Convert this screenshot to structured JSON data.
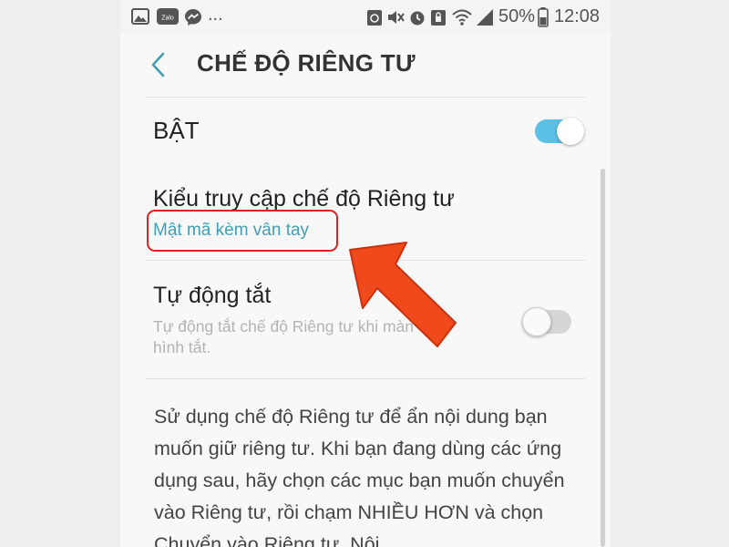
{
  "status_bar": {
    "app_icons": [
      "gallery-icon",
      "zalo-icon",
      "messenger-icon"
    ],
    "zalo_label": "Zalo",
    "more": "...",
    "battery": "50%",
    "time": "12:08"
  },
  "header": {
    "title": "CHẾ ĐỘ RIÊNG TƯ"
  },
  "master_switch": {
    "label": "BẬT",
    "state": "on"
  },
  "access_type": {
    "label": "Kiểu truy cập chế độ Riêng tư",
    "value": "Mật mã kèm vân tay"
  },
  "auto_off": {
    "label": "Tự động tắt",
    "hint_line1": "Tự động tắt chế độ Riêng tư khi màn",
    "hint_line2": "hình tắt.",
    "state": "off"
  },
  "description": "Sử dụng chế độ Riêng tư để ẩn nội dung bạn muốn giữ riêng tư. Khi bạn đang dùng các ứng dụng sau, hãy chọn các mục bạn muốn chuyển vào Riêng tư, rồi chạm NHIỀU HƠN và chọn Chuyển vào Riêng tư. Nội",
  "colors": {
    "accent": "#5bbfe6",
    "link": "#3f9fb8",
    "highlight_box": "#e02020",
    "arrow": "#f04a1c"
  }
}
